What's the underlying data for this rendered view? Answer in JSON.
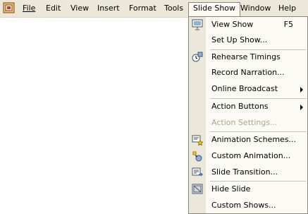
{
  "menubar": {
    "items": [
      {
        "label": "File",
        "mnemonic_index": 0
      },
      {
        "label": "Edit",
        "mnemonic_index": 0
      },
      {
        "label": "View",
        "mnemonic_index": 0
      },
      {
        "label": "Insert",
        "mnemonic_index": 0
      },
      {
        "label": "Format",
        "mnemonic_index": 1
      },
      {
        "label": "Tools",
        "mnemonic_index": 0
      },
      {
        "label": "Slide Show",
        "mnemonic_index": 1
      },
      {
        "label": "Window",
        "mnemonic_index": 0
      },
      {
        "label": "Help",
        "mnemonic_index": 0
      }
    ]
  },
  "dropdown": {
    "items": [
      {
        "label": "View Show",
        "shortcut": "F5",
        "icon": "projector-screen-icon",
        "enabled": true
      },
      {
        "label": "Set Up Show...",
        "icon": "",
        "enabled": true
      },
      {
        "label": "Rehearse Timings",
        "icon": "rehearse-timings-icon",
        "enabled": true
      },
      {
        "label": "Record Narration...",
        "icon": "",
        "enabled": true
      },
      {
        "label": "Online Broadcast",
        "icon": "",
        "enabled": true,
        "submenu": true
      },
      {
        "label": "Action Buttons",
        "icon": "",
        "enabled": true,
        "submenu": true
      },
      {
        "label": "Action Settings...",
        "icon": "",
        "enabled": false
      },
      {
        "label": "Animation Schemes...",
        "icon": "animation-schemes-icon",
        "enabled": true
      },
      {
        "label": "Custom Animation...",
        "icon": "custom-animation-icon",
        "enabled": true
      },
      {
        "label": "Slide Transition...",
        "icon": "slide-transition-icon",
        "enabled": true
      },
      {
        "label": "Hide Slide",
        "icon": "hide-slide-icon",
        "enabled": true
      },
      {
        "label": "Custom Shows...",
        "icon": "",
        "enabled": true
      }
    ]
  }
}
